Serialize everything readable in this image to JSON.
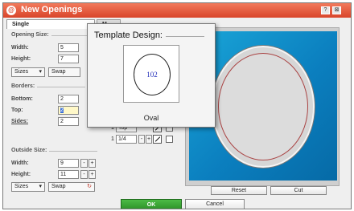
{
  "window": {
    "title": "New Openings",
    "app_icon": "@",
    "help": "?",
    "close": "⊠"
  },
  "tabs": [
    {
      "label": "Single"
    },
    {
      "label": "M"
    }
  ],
  "opening_size": {
    "title": "Opening Size:",
    "width_label": "Width:",
    "width_value": "5",
    "height_label": "Height:",
    "height_value": "7",
    "sizes_label": "Sizes",
    "swap_label": "Swap"
  },
  "borders": {
    "title": "Borders:",
    "bottom_label": "Bottom:",
    "bottom_value": "2",
    "top_label": "Top:",
    "top_value": "2",
    "sides_label": "Sides:",
    "sides_value": "2"
  },
  "mats": [
    {
      "num": "1",
      "value": "Top"
    },
    {
      "num": "1",
      "value": "1/4"
    }
  ],
  "outside_size": {
    "title": "Outside Size:",
    "width_label": "Width:",
    "width_value": "9",
    "height_label": "Height:",
    "height_value": "11",
    "sizes_label": "Sizes",
    "swap_label": "Swap"
  },
  "steppers": {
    "minus": "-",
    "plus": "+"
  },
  "preview": {
    "reset_label": "Reset",
    "cut_label": "Cut"
  },
  "footer": {
    "ok_label": "OK",
    "cancel_label": "Cancel"
  },
  "popup": {
    "title": "Template Design:",
    "number": "102",
    "name": "Oval"
  }
}
